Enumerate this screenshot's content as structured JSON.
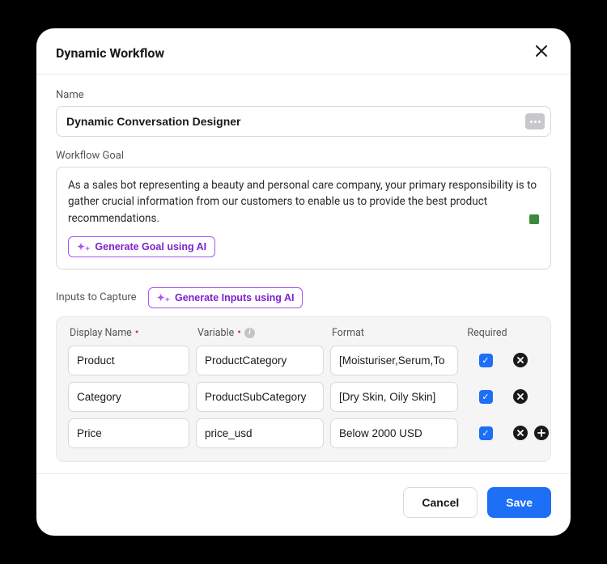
{
  "header": {
    "title": "Dynamic Workflow"
  },
  "name": {
    "label": "Name",
    "value": "Dynamic Conversation Designer"
  },
  "goal": {
    "label": "Workflow Goal",
    "text": "As a sales bot representing a beauty and personal care company, your primary responsibility is to gather crucial information from our customers to enable us to provide the best product recommendations.",
    "generate_label": "Generate Goal using AI"
  },
  "inputs": {
    "label": "Inputs to Capture",
    "generate_label": "Generate Inputs using AI",
    "columns": {
      "display_name": "Display Name",
      "variable": "Variable",
      "format": "Format",
      "required": "Required"
    },
    "rows": [
      {
        "display_name": "Product",
        "variable": "ProductCategory",
        "format": "[Moisturiser,Serum,To",
        "required": true
      },
      {
        "display_name": "Category",
        "variable": "ProductSubCategory",
        "format": "[Dry Skin, Oily Skin]",
        "required": true
      },
      {
        "display_name": "Price",
        "variable": "price_usd",
        "format": "Below 2000 USD",
        "required": true
      }
    ]
  },
  "footer": {
    "cancel": "Cancel",
    "save": "Save"
  }
}
